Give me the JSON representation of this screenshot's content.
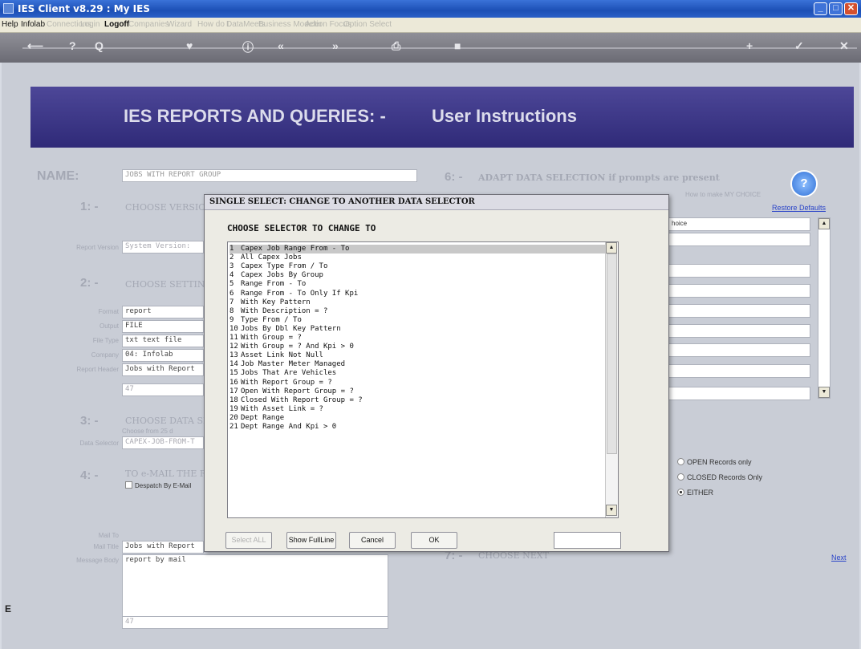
{
  "window": {
    "title": "IES Client v8.29 : My IES"
  },
  "menu": {
    "items": [
      {
        "label": "Help",
        "active": true
      },
      {
        "label": "Infolab",
        "active": true
      },
      {
        "label": "Connections",
        "active": false
      },
      {
        "label": "Login",
        "active": false
      },
      {
        "label": "Logoff",
        "active": true
      },
      {
        "label": "Companies",
        "active": false
      },
      {
        "label": "Wizard",
        "active": false
      },
      {
        "label": "How do I",
        "active": false
      },
      {
        "label": "DataMeets",
        "active": false
      },
      {
        "label": "Business Modeler",
        "active": false
      },
      {
        "label": "Action Focus",
        "active": false
      },
      {
        "label": "Option Select",
        "active": false
      }
    ]
  },
  "toolbar": {
    "icons": [
      "back-arrow-icon",
      "help-icon",
      "search-icon",
      "heart-icon",
      "info-icon",
      "rewind-icon",
      "forward-icon",
      "print-icon",
      "stop-icon",
      "plus-icon",
      "check-icon",
      "close-icon"
    ],
    "glyphs": [
      "⟵",
      "?",
      "Q",
      "♥",
      "ⓘ",
      "«",
      "»",
      "⎙",
      "■",
      "+",
      "✓",
      "✕"
    ]
  },
  "header": {
    "title": "IES REPORTS AND QUERIES: -",
    "subtitle": "User Instructions"
  },
  "form": {
    "name_label": "NAME:",
    "name_value": "JOBS WITH REPORT GROUP",
    "step1": {
      "num": "1: -",
      "label": "CHOOSE VERSION"
    },
    "report_version_label": "Report Version",
    "report_version_value": "System Version:",
    "step2": {
      "num": "2: -",
      "label": "CHOOSE SETTING"
    },
    "format_label": "Format",
    "format_value": "report",
    "output_label": "Output",
    "output_value": "FILE",
    "filetype_label": "File Type",
    "filetype_value": "txt text file",
    "company_label": "Company",
    "company_value": "04: Infolab",
    "report_header_label": "Report Header",
    "report_header_value": "Jobs with Report",
    "report_header_extra": "47",
    "step3": {
      "num": "3: -",
      "label": "CHOOSE DATA SE"
    },
    "choose_from": "Choose from 25 d",
    "data_selector_label": "Data Selector",
    "data_selector_value": "CAPEX-JOB-FROM-T",
    "step4": {
      "num": "4: -",
      "label": "TO e-MAIL THE RE"
    },
    "dispatch_label": "Despatch By E-Mail",
    "mail_to_label": "Mail To",
    "mail_title_label": "Mail Title",
    "mail_title_value": "Jobs with Report",
    "message_body_label": "Message Body",
    "message_body_value": "report by mail",
    "message_extra": "47",
    "step6": {
      "num": "6: -",
      "label": "ADAPT DATA SELECTION if prompts are present"
    },
    "how_to": "How to make MY CHOICE",
    "restore_defaults": "Restore Defaults",
    "choice_header": "hoice",
    "radios": [
      {
        "label": "OPEN Records only",
        "selected": false
      },
      {
        "label": "CLOSED Records Only",
        "selected": false
      },
      {
        "label": "EITHER",
        "selected": true
      }
    ],
    "step7": {
      "num": "7: -",
      "label": "CHOOSE NEXT"
    },
    "next_link": "Next",
    "corner_letter": "E"
  },
  "dialog": {
    "title": "SINGLE SELECT: CHANGE TO ANOTHER DATA SELECTOR",
    "heading": "CHOOSE SELECTOR TO CHANGE TO",
    "items": [
      {
        "num": "1",
        "label": "Capex Job Range From - To"
      },
      {
        "num": "2",
        "label": "All Capex Jobs"
      },
      {
        "num": "3",
        "label": "Capex Type From / To"
      },
      {
        "num": "4",
        "label": "Capex Jobs By Group"
      },
      {
        "num": "5",
        "label": "Range From - To"
      },
      {
        "num": "6",
        "label": "Range From - To Only If Kpi"
      },
      {
        "num": "7",
        "label": "With Key Pattern"
      },
      {
        "num": "8",
        "label": "With Description = ?"
      },
      {
        "num": "9",
        "label": "Type From / To"
      },
      {
        "num": "10",
        "label": "Jobs By Dbl Key Pattern"
      },
      {
        "num": "11",
        "label": "With Group = ?"
      },
      {
        "num": "12",
        "label": "With Group = ? And Kpi > 0"
      },
      {
        "num": "13",
        "label": "Asset Link Not Null"
      },
      {
        "num": "14",
        "label": "Job Master Meter Managed"
      },
      {
        "num": "15",
        "label": "Jobs That Are Vehicles"
      },
      {
        "num": "16",
        "label": "With Report Group = ?"
      },
      {
        "num": "17",
        "label": "Open With Report Group = ?"
      },
      {
        "num": "18",
        "label": "Closed With Report Group = ?"
      },
      {
        "num": "19",
        "label": "With Asset Link = ?"
      },
      {
        "num": "20",
        "label": "Dept Range"
      },
      {
        "num": "21",
        "label": "Dept Range And Kpi > 0"
      }
    ],
    "selected_index": 0,
    "buttons": {
      "select_all": "Select ALL",
      "show_full_line": "Show FullLine",
      "cancel": "Cancel",
      "ok": "OK"
    }
  }
}
